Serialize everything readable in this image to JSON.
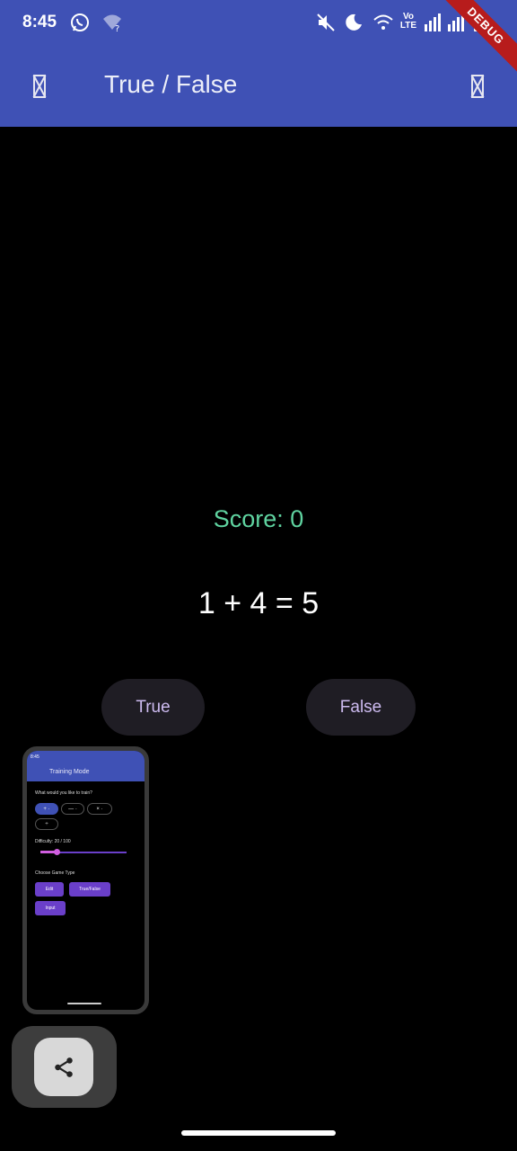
{
  "status_bar": {
    "time": "8:45",
    "network_label": "Vo LTE",
    "icons": [
      "whatsapp-icon",
      "wifi-question-icon",
      "mute-icon",
      "do-not-disturb-moon-icon",
      "wifi-icon",
      "signal-icon",
      "battery-icon"
    ],
    "debug_banner": "DEBUG"
  },
  "app_bar": {
    "title": "True / False",
    "background_color": "#3f51b5",
    "leading_icon": "missing-glyph-icon",
    "trailing_icon": "missing-glyph-icon"
  },
  "game": {
    "score": "Score: 0",
    "equation": "1 + 4 = 5",
    "score_color": "#5fd3a0",
    "true_label": "True",
    "false_label": "False"
  },
  "preview": {
    "time": "8:45",
    "title": "Training Mode",
    "question": "What would you like to train?",
    "chips": [
      "+ ·",
      "— ·",
      "× ·",
      "÷"
    ],
    "difficulty_label": "Difficulty: 20 / 100",
    "game_type_label": "Choose Game Type",
    "buttons": [
      "Edit",
      "True/False",
      "Input"
    ]
  },
  "share": {
    "icon": "share-icon"
  }
}
